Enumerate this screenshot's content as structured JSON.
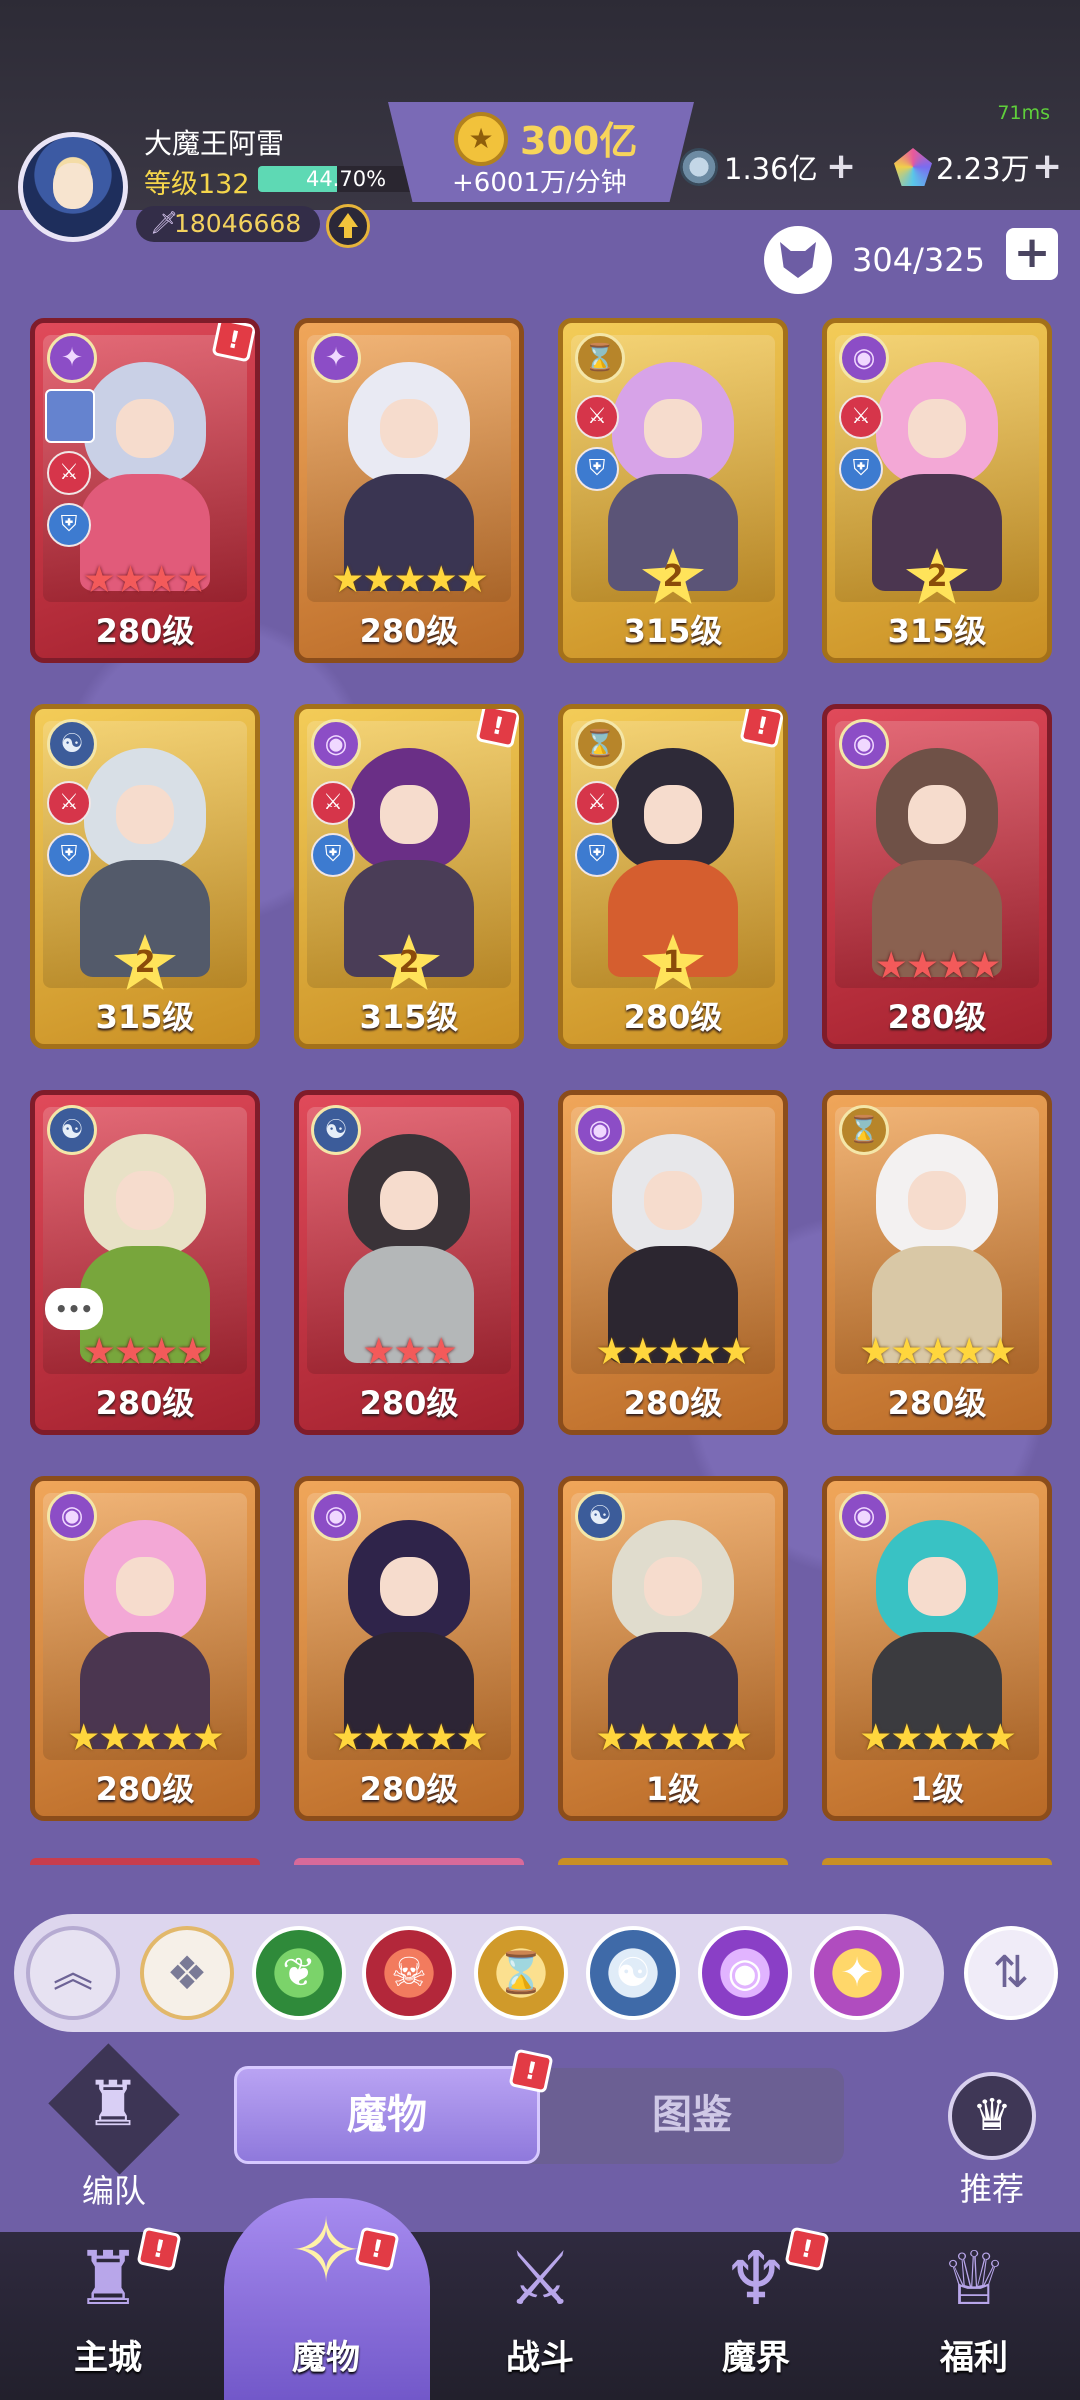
{
  "header": {
    "player_name": "大魔王阿雷",
    "level_label": "等级132",
    "xp_percent_text": "44.70%",
    "xp_fraction": 0.447,
    "combat_power": "18046668",
    "ping": "71ms",
    "gold": "300亿",
    "gold_rate": "+6001万/分钟",
    "diamond": "1.36亿",
    "gem": "2.23万",
    "plus_glyph": "+"
  },
  "roster": {
    "count": "304/325",
    "add_label": "+"
  },
  "cards": [
    {
      "level": "280级",
      "faction": "chaos",
      "faction_glyph": "✦",
      "stars": "★★★★",
      "star_color": "red",
      "awaken": "",
      "frame": "red",
      "notif": true,
      "team_thumb": true,
      "hair": "#c9d0e6",
      "body": "#e15b7a"
    },
    {
      "level": "280级",
      "faction": "chaos",
      "faction_glyph": "✦",
      "stars": "★★★★★",
      "star_color": "gold",
      "awaken": "",
      "frame": "orange",
      "notif": false,
      "team_thumb": false,
      "hair": "#e9eaf3",
      "body": "#3a3552"
    },
    {
      "level": "315级",
      "faction": "time",
      "faction_glyph": "⌛",
      "stars": "",
      "star_color": "gold",
      "awaken": "2",
      "frame": "gold",
      "notif": false,
      "team_thumb": false,
      "hair": "#d7a3e8",
      "body": "#5b5477"
    },
    {
      "level": "315级",
      "faction": "eye",
      "faction_glyph": "◉",
      "stars": "",
      "star_color": "gold",
      "awaken": "2",
      "frame": "gold",
      "notif": false,
      "team_thumb": false,
      "hair": "#f3a8d6",
      "body": "#4b3650"
    },
    {
      "level": "315级",
      "faction": "dragon",
      "faction_glyph": "☯",
      "stars": "",
      "star_color": "gold",
      "awaken": "2",
      "frame": "gold",
      "notif": false,
      "team_thumb": false,
      "hair": "#d8dfe6",
      "body": "#535a6a"
    },
    {
      "level": "315级",
      "faction": "eye",
      "faction_glyph": "◉",
      "stars": "",
      "star_color": "gold",
      "awaken": "2",
      "frame": "gold",
      "notif": true,
      "team_thumb": false,
      "hair": "#6a2f86",
      "body": "#4a3d57"
    },
    {
      "level": "280级",
      "faction": "time",
      "faction_glyph": "⌛",
      "stars": "",
      "star_color": "gold",
      "awaken": "1",
      "frame": "gold",
      "notif": true,
      "team_thumb": false,
      "hair": "#2e2a38",
      "body": "#d55e2f"
    },
    {
      "level": "280级",
      "faction": "eye",
      "faction_glyph": "◉",
      "stars": "★★★★",
      "star_color": "red",
      "awaken": "",
      "frame": "red",
      "notif": false,
      "team_thumb": false,
      "hair": "#6f5147",
      "body": "#8a6150"
    },
    {
      "level": "280级",
      "faction": "dragon",
      "faction_glyph": "☯",
      "stars": "★★★★",
      "star_color": "red",
      "awaken": "",
      "frame": "red",
      "notif": false,
      "team_thumb": false,
      "hair": "#e8e1c6",
      "body": "#78a63c"
    },
    {
      "level": "280级",
      "faction": "dragon",
      "faction_glyph": "☯",
      "stars": "★★★",
      "star_color": "red",
      "awaken": "",
      "frame": "red",
      "notif": false,
      "team_thumb": false,
      "hair": "#3a3338",
      "body": "#b4b7b8"
    },
    {
      "level": "280级",
      "faction": "eye",
      "faction_glyph": "◉",
      "stars": "★★★★★",
      "star_color": "gold",
      "awaken": "",
      "frame": "orange",
      "notif": false,
      "team_thumb": false,
      "hair": "#e7e7ea",
      "body": "#2c2630"
    },
    {
      "level": "280级",
      "faction": "time",
      "faction_glyph": "⌛",
      "stars": "★★★★★",
      "star_color": "gold",
      "awaken": "",
      "frame": "orange",
      "notif": false,
      "team_thumb": false,
      "hair": "#f3f1f1",
      "body": "#d9c8a6"
    },
    {
      "level": "280级",
      "faction": "eye",
      "faction_glyph": "◉",
      "stars": "★★★★★",
      "star_color": "gold",
      "awaken": "",
      "frame": "orange",
      "notif": false,
      "team_thumb": false,
      "hair": "#f3a8d6",
      "body": "#4b3650"
    },
    {
      "level": "280级",
      "faction": "eye",
      "faction_glyph": "◉",
      "stars": "★★★★★",
      "star_color": "gold",
      "awaken": "",
      "frame": "orange",
      "notif": false,
      "team_thumb": false,
      "hair": "#2f244a",
      "body": "#2d2535"
    },
    {
      "level": "1级",
      "faction": "dragon",
      "faction_glyph": "☯",
      "stars": "★★★★★",
      "star_color": "gold",
      "awaken": "",
      "frame": "orange",
      "notif": false,
      "team_thumb": false,
      "hair": "#e0dccd",
      "body": "#3a3147"
    },
    {
      "level": "1级",
      "faction": "eye",
      "faction_glyph": "◉",
      "stars": "★★★★★",
      "star_color": "gold",
      "awaken": "",
      "frame": "orange",
      "notif": false,
      "team_thumb": false,
      "hair": "#39c2c4",
      "body": "#3b3b3f"
    }
  ],
  "filters": [
    {
      "id": "nature",
      "glyph": "❦"
    },
    {
      "id": "demon",
      "glyph": "☠"
    },
    {
      "id": "time",
      "glyph": "⌛"
    },
    {
      "id": "dragon",
      "glyph": "☯"
    },
    {
      "id": "eye",
      "glyph": "◉"
    },
    {
      "id": "chaos",
      "glyph": "✦"
    }
  ],
  "bottom": {
    "formation_label": "编队",
    "tab_monsters": "魔物",
    "tab_codex": "图鉴",
    "recommend_label": "推荐"
  },
  "nav": [
    {
      "label": "主城",
      "glyph": "♜",
      "active": false,
      "notif": true
    },
    {
      "label": "魔物",
      "glyph": "✧",
      "active": true,
      "notif": true
    },
    {
      "label": "战斗",
      "glyph": "⚔",
      "active": false,
      "notif": false
    },
    {
      "label": "魔界",
      "glyph": "♆",
      "active": false,
      "notif": true
    },
    {
      "label": "福利",
      "glyph": "♕",
      "active": false,
      "notif": false
    }
  ],
  "colors": {
    "background": "#6f5fa6",
    "accent_purple": "#8f79dc",
    "gold_text": "#f7d55a",
    "notif_red": "#e23b45"
  }
}
